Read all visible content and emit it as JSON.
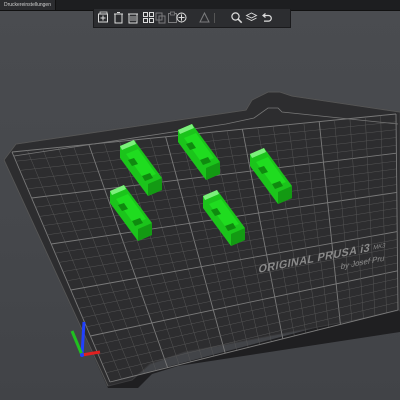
{
  "tab": {
    "label": "Druckereinstellungen"
  },
  "toolbar": {
    "buttons": [
      {
        "name": "add-icon"
      },
      {
        "name": "delete-icon"
      },
      {
        "name": "delete-all-icon"
      },
      {
        "name": "arrange-icon"
      },
      {
        "name": "copy-icon"
      },
      {
        "name": "paste-icon"
      },
      {
        "name": "add-instance-icon"
      },
      {
        "name": "split-icon"
      },
      {
        "name": "search-icon"
      },
      {
        "name": "layers-icon"
      },
      {
        "name": "undo-icon"
      }
    ]
  },
  "bed": {
    "brand_label": "ORIGINAL PRUSA i3",
    "model_label": "MK3",
    "maker_label": "by Josef Pru"
  },
  "colors": {
    "model_green": "#1fdc1f",
    "bed_top": "#2e2e30",
    "bed_edge": "#1e1e20",
    "grid": "#6a6a6a",
    "axis_x": "#e02020",
    "axis_y": "#20c020",
    "axis_z": "#2040ff"
  }
}
